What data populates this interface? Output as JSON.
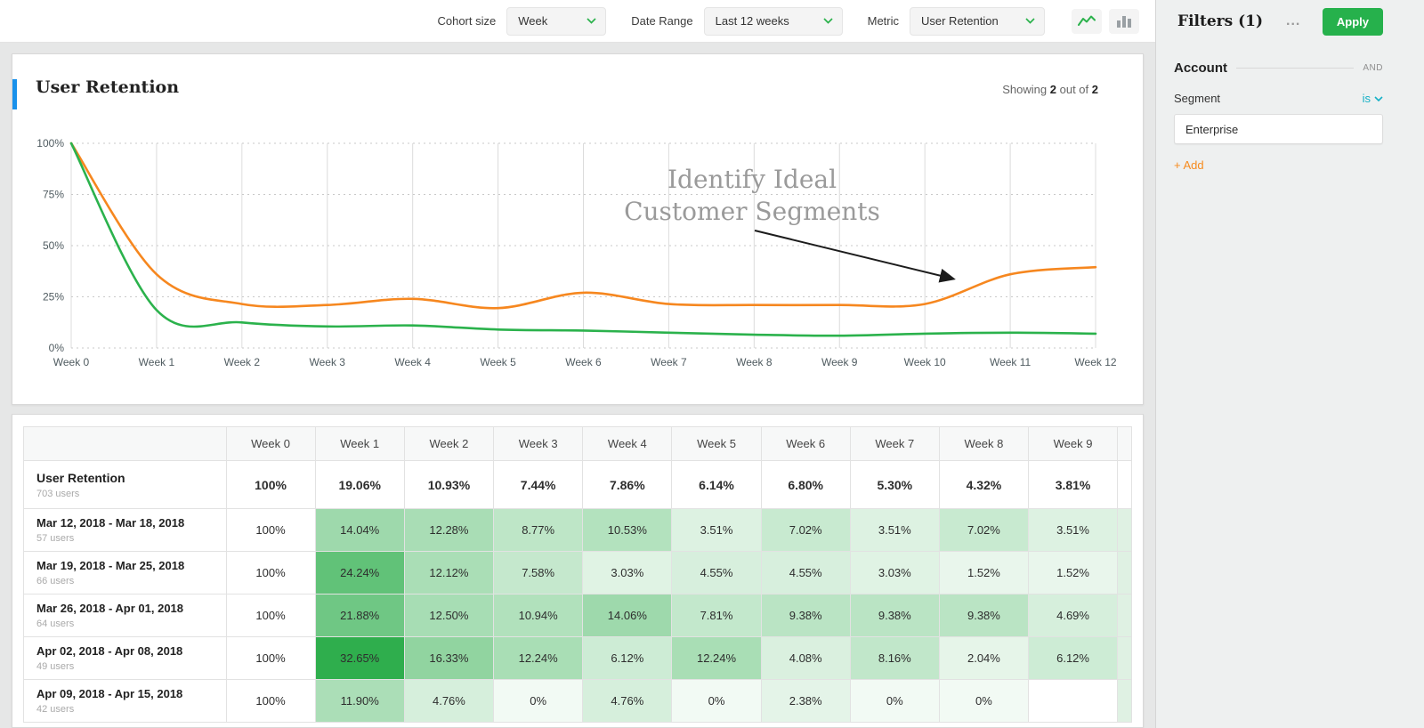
{
  "toolbar": {
    "cohort_size_label": "Cohort size",
    "cohort_size_value": "Week",
    "date_range_label": "Date Range",
    "date_range_value": "Last 12 weeks",
    "metric_label": "Metric",
    "metric_value": "User Retention",
    "icons": [
      "line-chart-icon",
      "bar-chart-icon"
    ]
  },
  "filters_panel": {
    "title": "Filters (1)",
    "menu": "...",
    "apply_label": "Apply",
    "group_label": "Account",
    "group_operator": "AND",
    "property_label": "Segment",
    "operator": "is",
    "value": "Enterprise",
    "add_label": "+ Add"
  },
  "chart_card": {
    "title": "User Retention",
    "showing": {
      "prefix": "Showing",
      "count": "2",
      "middle": "out of",
      "total": "2"
    }
  },
  "chart_data": {
    "type": "line",
    "x": [
      "Week 0",
      "Week 1",
      "Week 2",
      "Week 3",
      "Week 4",
      "Week 5",
      "Week 6",
      "Week 7",
      "Week 8",
      "Week 9",
      "Week 10",
      "Week 11",
      "Week 12"
    ],
    "y_ticks": [
      "100%",
      "75%",
      "50%",
      "25%",
      "0%"
    ],
    "ylim": [
      0,
      100
    ],
    "grid": true,
    "legend": false,
    "series": [
      {
        "name": "orange-segment-line",
        "color": "#f6871f",
        "values": [
          100,
          36,
          21.5,
          21,
          24,
          19.5,
          27,
          21.5,
          21,
          21,
          21.5,
          36,
          39.5
        ]
      },
      {
        "name": "green-segment-line",
        "color": "#2bb24c",
        "values": [
          100,
          18.5,
          12.5,
          10.5,
          11,
          9,
          8.5,
          7.5,
          6.5,
          6,
          7,
          7.5,
          7
        ]
      }
    ],
    "annotation": {
      "line1": "Identify Ideal",
      "line2": "Customer Segments",
      "color": "#9a9a9a"
    }
  },
  "table": {
    "header": [
      "Week 0",
      "Week 1",
      "Week 2",
      "Week 3",
      "Week 4",
      "Week 5",
      "Week 6",
      "Week 7",
      "Week 8",
      "Week 9"
    ],
    "summary_row": {
      "title": "User Retention",
      "subtitle": "703 users",
      "values": [
        "100%",
        "19.06%",
        "10.93%",
        "7.44%",
        "7.86%",
        "6.14%",
        "6.80%",
        "5.30%",
        "4.32%",
        "3.81%"
      ]
    },
    "rows": [
      {
        "title": "Mar 12, 2018 - Mar 18, 2018",
        "subtitle": "57 users",
        "values": [
          "100%",
          "14.04%",
          "12.28%",
          "8.77%",
          "10.53%",
          "3.51%",
          "7.02%",
          "3.51%",
          "7.02%",
          "3.51%"
        ]
      },
      {
        "title": "Mar 19, 2018 - Mar 25, 2018",
        "subtitle": "66 users",
        "values": [
          "100%",
          "24.24%",
          "12.12%",
          "7.58%",
          "3.03%",
          "4.55%",
          "4.55%",
          "3.03%",
          "1.52%",
          "1.52%"
        ]
      },
      {
        "title": "Mar 26, 2018 - Apr 01, 2018",
        "subtitle": "64 users",
        "values": [
          "100%",
          "21.88%",
          "12.50%",
          "10.94%",
          "14.06%",
          "7.81%",
          "9.38%",
          "9.38%",
          "9.38%",
          "4.69%"
        ]
      },
      {
        "title": "Apr 02, 2018 - Apr 08, 2018",
        "subtitle": "49 users",
        "values": [
          "100%",
          "32.65%",
          "16.33%",
          "12.24%",
          "6.12%",
          "12.24%",
          "4.08%",
          "8.16%",
          "2.04%",
          "6.12%"
        ]
      },
      {
        "title": "Apr 09, 2018 - Apr 15, 2018",
        "subtitle": "42 users",
        "values": [
          "100%",
          "11.90%",
          "4.76%",
          "0%",
          "4.76%",
          "0%",
          "2.38%",
          "0%",
          "0%",
          ""
        ]
      }
    ]
  },
  "colors": {
    "apply_green": "#26b14c",
    "accent_blue": "#1991eb",
    "link_teal": "#15b0c6",
    "add_orange": "#f78b1e",
    "cell_green": "#27ab46"
  }
}
